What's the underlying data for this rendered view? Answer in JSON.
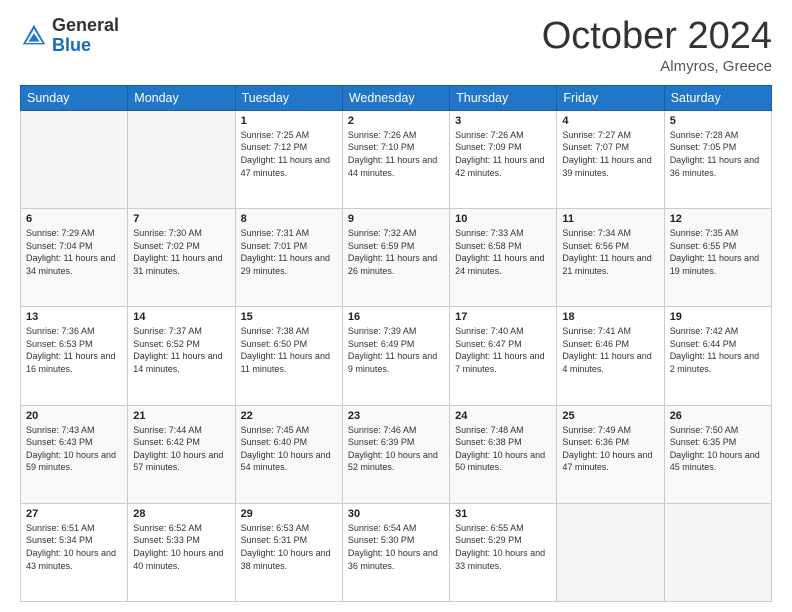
{
  "header": {
    "logo_general": "General",
    "logo_blue": "Blue",
    "month_title": "October 2024",
    "location": "Almyros, Greece"
  },
  "weekdays": [
    "Sunday",
    "Monday",
    "Tuesday",
    "Wednesday",
    "Thursday",
    "Friday",
    "Saturday"
  ],
  "weeks": [
    [
      {
        "day": "",
        "info": ""
      },
      {
        "day": "",
        "info": ""
      },
      {
        "day": "1",
        "info": "Sunrise: 7:25 AM\nSunset: 7:12 PM\nDaylight: 11 hours and 47 minutes."
      },
      {
        "day": "2",
        "info": "Sunrise: 7:26 AM\nSunset: 7:10 PM\nDaylight: 11 hours and 44 minutes."
      },
      {
        "day": "3",
        "info": "Sunrise: 7:26 AM\nSunset: 7:09 PM\nDaylight: 11 hours and 42 minutes."
      },
      {
        "day": "4",
        "info": "Sunrise: 7:27 AM\nSunset: 7:07 PM\nDaylight: 11 hours and 39 minutes."
      },
      {
        "day": "5",
        "info": "Sunrise: 7:28 AM\nSunset: 7:05 PM\nDaylight: 11 hours and 36 minutes."
      }
    ],
    [
      {
        "day": "6",
        "info": "Sunrise: 7:29 AM\nSunset: 7:04 PM\nDaylight: 11 hours and 34 minutes."
      },
      {
        "day": "7",
        "info": "Sunrise: 7:30 AM\nSunset: 7:02 PM\nDaylight: 11 hours and 31 minutes."
      },
      {
        "day": "8",
        "info": "Sunrise: 7:31 AM\nSunset: 7:01 PM\nDaylight: 11 hours and 29 minutes."
      },
      {
        "day": "9",
        "info": "Sunrise: 7:32 AM\nSunset: 6:59 PM\nDaylight: 11 hours and 26 minutes."
      },
      {
        "day": "10",
        "info": "Sunrise: 7:33 AM\nSunset: 6:58 PM\nDaylight: 11 hours and 24 minutes."
      },
      {
        "day": "11",
        "info": "Sunrise: 7:34 AM\nSunset: 6:56 PM\nDaylight: 11 hours and 21 minutes."
      },
      {
        "day": "12",
        "info": "Sunrise: 7:35 AM\nSunset: 6:55 PM\nDaylight: 11 hours and 19 minutes."
      }
    ],
    [
      {
        "day": "13",
        "info": "Sunrise: 7:36 AM\nSunset: 6:53 PM\nDaylight: 11 hours and 16 minutes."
      },
      {
        "day": "14",
        "info": "Sunrise: 7:37 AM\nSunset: 6:52 PM\nDaylight: 11 hours and 14 minutes."
      },
      {
        "day": "15",
        "info": "Sunrise: 7:38 AM\nSunset: 6:50 PM\nDaylight: 11 hours and 11 minutes."
      },
      {
        "day": "16",
        "info": "Sunrise: 7:39 AM\nSunset: 6:49 PM\nDaylight: 11 hours and 9 minutes."
      },
      {
        "day": "17",
        "info": "Sunrise: 7:40 AM\nSunset: 6:47 PM\nDaylight: 11 hours and 7 minutes."
      },
      {
        "day": "18",
        "info": "Sunrise: 7:41 AM\nSunset: 6:46 PM\nDaylight: 11 hours and 4 minutes."
      },
      {
        "day": "19",
        "info": "Sunrise: 7:42 AM\nSunset: 6:44 PM\nDaylight: 11 hours and 2 minutes."
      }
    ],
    [
      {
        "day": "20",
        "info": "Sunrise: 7:43 AM\nSunset: 6:43 PM\nDaylight: 10 hours and 59 minutes."
      },
      {
        "day": "21",
        "info": "Sunrise: 7:44 AM\nSunset: 6:42 PM\nDaylight: 10 hours and 57 minutes."
      },
      {
        "day": "22",
        "info": "Sunrise: 7:45 AM\nSunset: 6:40 PM\nDaylight: 10 hours and 54 minutes."
      },
      {
        "day": "23",
        "info": "Sunrise: 7:46 AM\nSunset: 6:39 PM\nDaylight: 10 hours and 52 minutes."
      },
      {
        "day": "24",
        "info": "Sunrise: 7:48 AM\nSunset: 6:38 PM\nDaylight: 10 hours and 50 minutes."
      },
      {
        "day": "25",
        "info": "Sunrise: 7:49 AM\nSunset: 6:36 PM\nDaylight: 10 hours and 47 minutes."
      },
      {
        "day": "26",
        "info": "Sunrise: 7:50 AM\nSunset: 6:35 PM\nDaylight: 10 hours and 45 minutes."
      }
    ],
    [
      {
        "day": "27",
        "info": "Sunrise: 6:51 AM\nSunset: 5:34 PM\nDaylight: 10 hours and 43 minutes."
      },
      {
        "day": "28",
        "info": "Sunrise: 6:52 AM\nSunset: 5:33 PM\nDaylight: 10 hours and 40 minutes."
      },
      {
        "day": "29",
        "info": "Sunrise: 6:53 AM\nSunset: 5:31 PM\nDaylight: 10 hours and 38 minutes."
      },
      {
        "day": "30",
        "info": "Sunrise: 6:54 AM\nSunset: 5:30 PM\nDaylight: 10 hours and 36 minutes."
      },
      {
        "day": "31",
        "info": "Sunrise: 6:55 AM\nSunset: 5:29 PM\nDaylight: 10 hours and 33 minutes."
      },
      {
        "day": "",
        "info": ""
      },
      {
        "day": "",
        "info": ""
      }
    ]
  ]
}
